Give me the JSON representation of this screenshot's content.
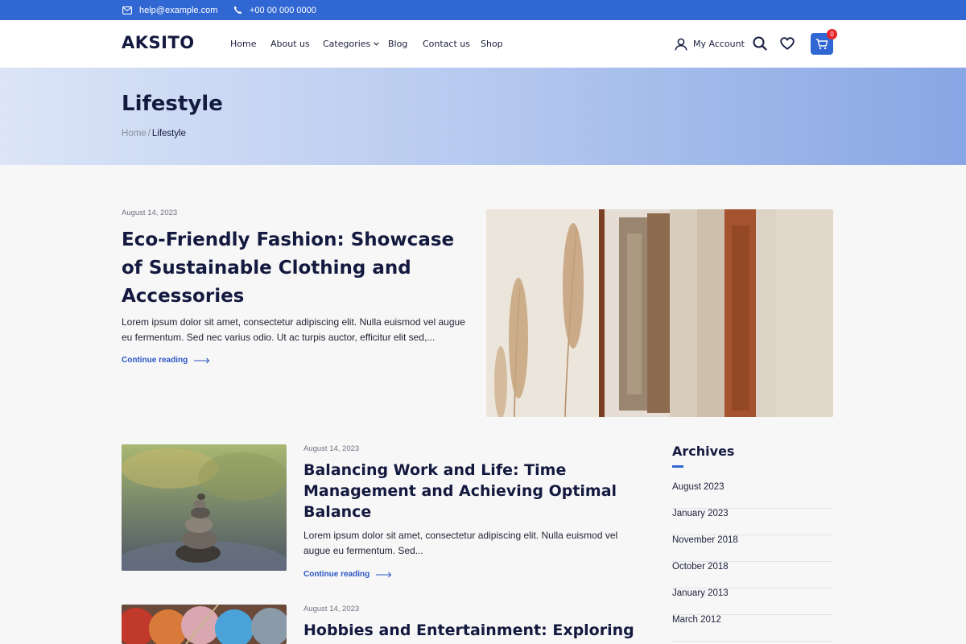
{
  "topbar": {
    "email": "help@example.com",
    "phone": "+00 00 000 0000"
  },
  "header": {
    "logo": "AKSITO",
    "nav": [
      {
        "label": "Home",
        "icon": ""
      },
      {
        "label": "About us",
        "icon": ""
      },
      {
        "label": "Categories",
        "icon": "chevron-down-icon"
      },
      {
        "label": "Blog",
        "icon": ""
      },
      {
        "label": "Contact us",
        "icon": ""
      },
      {
        "label": "Shop",
        "icon": ""
      }
    ],
    "account_label": "My Account",
    "cart_count": "0",
    "accent_color": "#3167d2"
  },
  "hero": {
    "title": "Lifestyle",
    "breadcrumb_home": "Home",
    "breadcrumb_sep": "/",
    "breadcrumb_current": "Lifestyle"
  },
  "featured": {
    "date": "August 14, 2023",
    "title": "Eco-Friendly Fashion: Showcase of Sustainable Clothing and Accessories",
    "excerpt": "Lorem ipsum dolor sit amet, consectetur adipiscing elit. Nulla euismod vel augue eu fermentum. Sed nec varius odio. Ut ac turpis auctor, efficitur elit sed,...",
    "link": "Continue reading"
  },
  "posts": [
    {
      "date": "August 14, 2023",
      "title": "Balancing Work and Life: Time Management and Achieving Optimal Balance",
      "excerpt": "Lorem ipsum dolor sit amet, consectetur adipiscing elit. Nulla euismod vel augue eu fermentum. Sed...",
      "link": "Continue reading"
    },
    {
      "date": "August 14, 2023",
      "title": "Hobbies and Entertainment: Exploring"
    }
  ],
  "sidebar": {
    "title": "Archives",
    "items": [
      "August 2023",
      "January 2023",
      "November 2018",
      "October 2018",
      "January 2013",
      "March 2012"
    ]
  }
}
